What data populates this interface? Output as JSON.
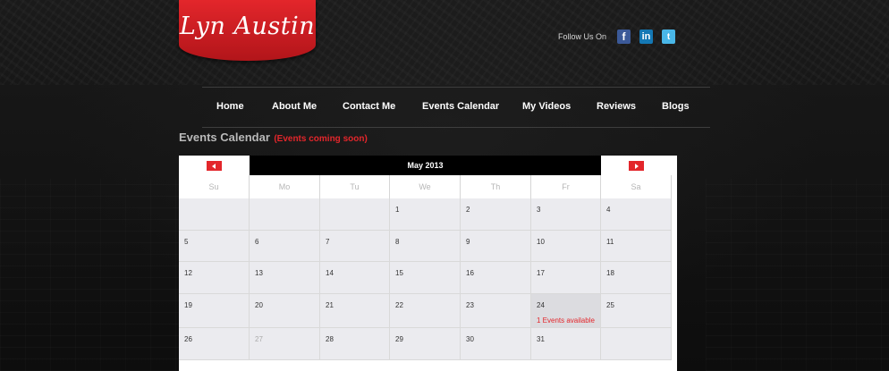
{
  "logo": {
    "text": "Lyn Austin"
  },
  "social": {
    "label": "Follow Us On",
    "icons": [
      {
        "name": "facebook-icon",
        "glyph": "f"
      },
      {
        "name": "linkedin-icon",
        "glyph": "in"
      },
      {
        "name": "twitter-icon",
        "glyph": "t"
      }
    ]
  },
  "nav": [
    "Home",
    "About Me",
    "Contact Me",
    "Events Calendar",
    "My Videos",
    "Reviews",
    "Blogs"
  ],
  "page": {
    "title": "Events Calendar",
    "subtitle": "(Events coming soon)"
  },
  "calendar": {
    "month": "May 2013",
    "days": [
      "Su",
      "Mo",
      "Tu",
      "We",
      "Th",
      "Fr",
      "Sa"
    ],
    "weeks": [
      [
        {
          "day": ""
        },
        {
          "day": ""
        },
        {
          "day": ""
        },
        {
          "day": "1"
        },
        {
          "day": "2"
        },
        {
          "day": "3"
        },
        {
          "day": "4"
        }
      ],
      [
        {
          "day": "5"
        },
        {
          "day": "6"
        },
        {
          "day": "7"
        },
        {
          "day": "8"
        },
        {
          "day": "9"
        },
        {
          "day": "10"
        },
        {
          "day": "11"
        }
      ],
      [
        {
          "day": "12"
        },
        {
          "day": "13"
        },
        {
          "day": "14"
        },
        {
          "day": "15"
        },
        {
          "day": "16"
        },
        {
          "day": "17"
        },
        {
          "day": "18"
        }
      ],
      [
        {
          "day": "19"
        },
        {
          "day": "20"
        },
        {
          "day": "21"
        },
        {
          "day": "22"
        },
        {
          "day": "23"
        },
        {
          "day": "24",
          "event": "1 Events available",
          "highlight": true
        },
        {
          "day": "25"
        }
      ],
      [
        {
          "day": "26"
        },
        {
          "day": "27",
          "muted": true
        },
        {
          "day": "28"
        },
        {
          "day": "29"
        },
        {
          "day": "30"
        },
        {
          "day": "31"
        },
        {
          "day": ""
        }
      ]
    ]
  }
}
